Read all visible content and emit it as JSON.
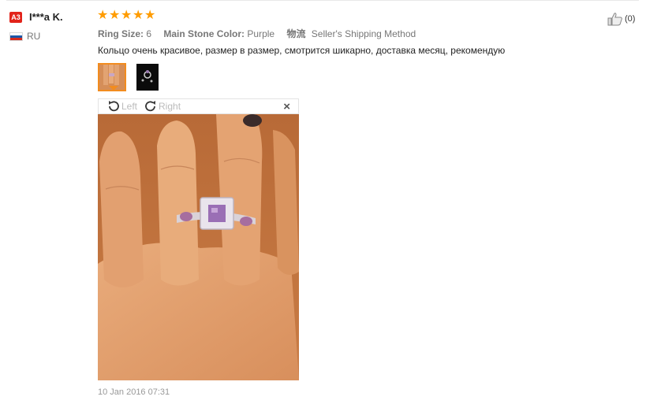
{
  "user": {
    "level_badge": "A3",
    "name": "I***a K.",
    "country": "RU"
  },
  "rating": {
    "stars": 5,
    "max": 5,
    "color": "#ff9c00"
  },
  "properties": [
    {
      "key": "Ring Size:",
      "value": "6"
    },
    {
      "key": "Main Stone Color:",
      "value": "Purple"
    },
    {
      "key": "物流",
      "value": "Seller's Shipping Method"
    }
  ],
  "review_text": "Кольцо очень красивое, размер в размер, смотрится шикарно, доставка месяц, рекомендую",
  "helpful": {
    "count": "(0)"
  },
  "viewer": {
    "rotate_left_label": "Left",
    "rotate_right_label": "Right",
    "close_label": "×"
  },
  "timestamp": "10 Jan 2016 07:31",
  "colors": {
    "accent": "#f28c1f",
    "badge": "#e2231a"
  }
}
